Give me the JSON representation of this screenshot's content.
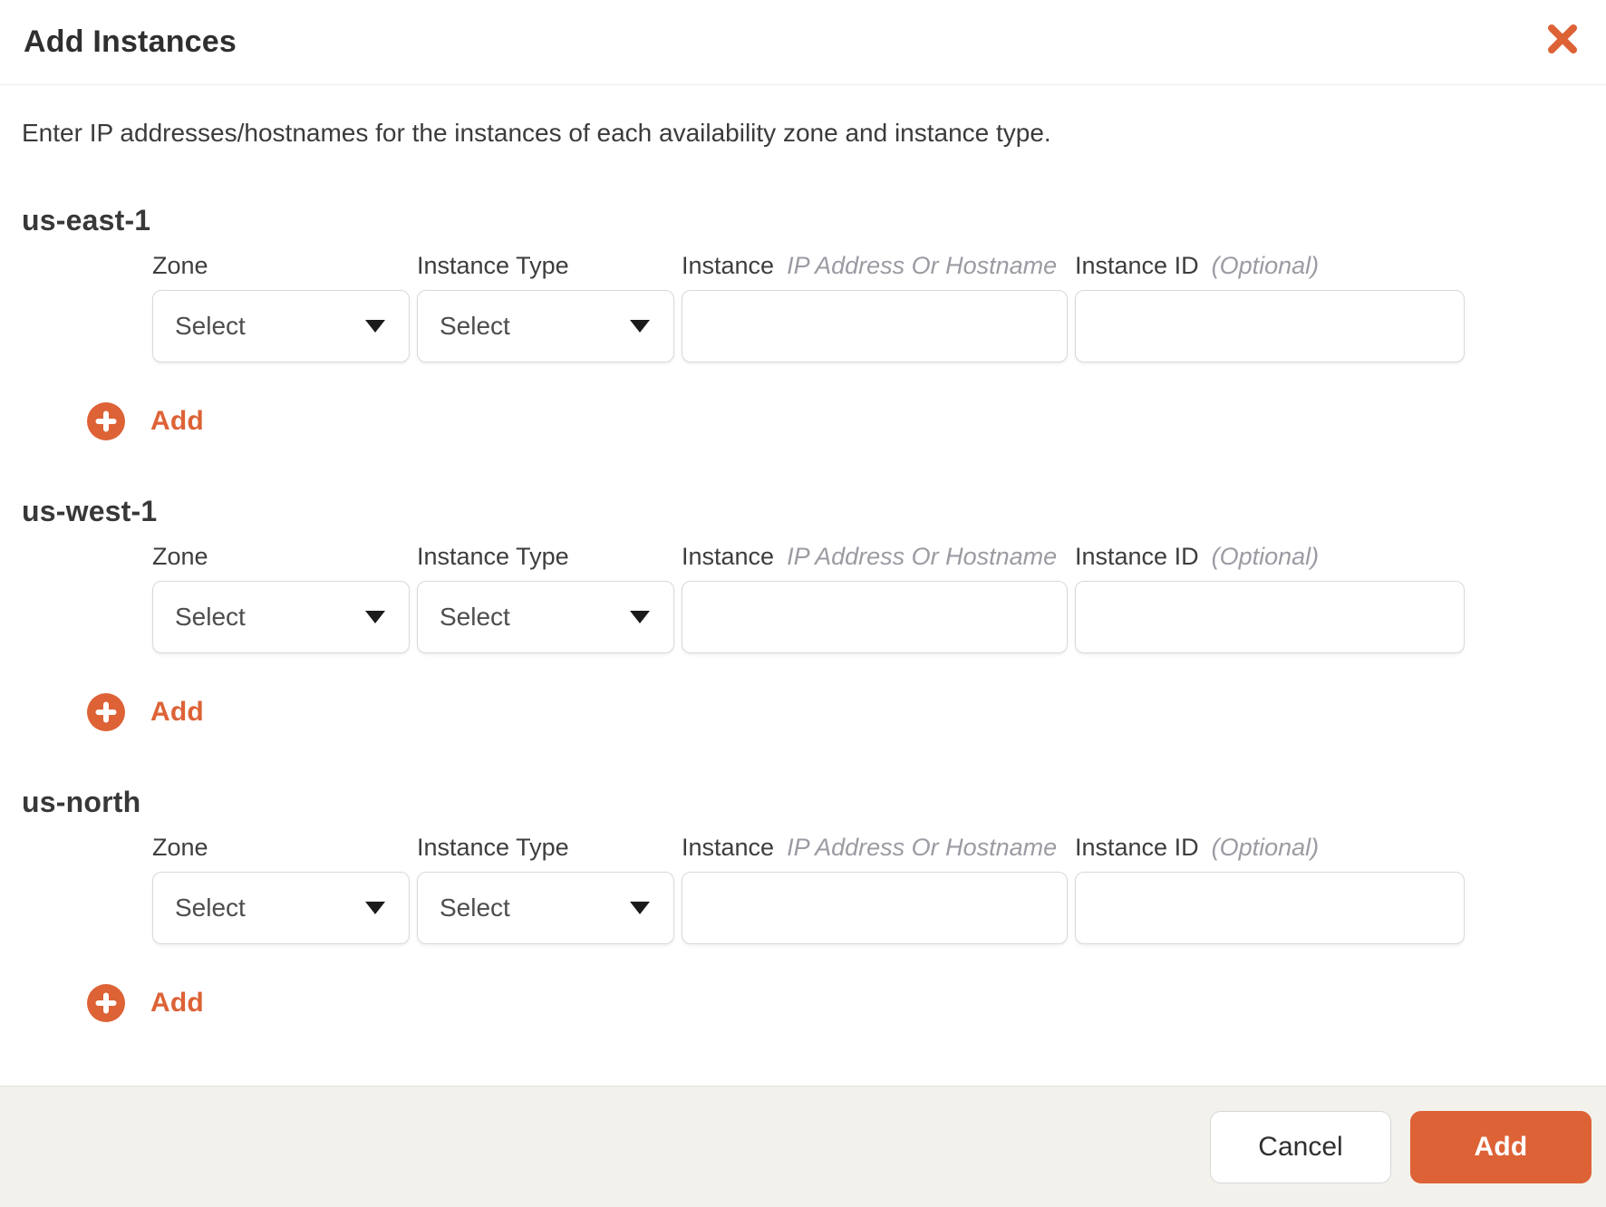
{
  "modal": {
    "title": "Add Instances",
    "description": "Enter IP addresses/hostnames for the instances of each availability zone and instance type."
  },
  "form": {
    "zone_label": "Zone",
    "instance_type_label": "Instance Type",
    "instance_label": "Instance",
    "instance_hint": "IP Address Or Hostname",
    "instance_id_label": "Instance ID",
    "instance_id_hint": "(Optional)",
    "select_placeholder": "Select",
    "add_row_label": "Add",
    "instance_value": "",
    "instance_id_value": ""
  },
  "sections": [
    {
      "title": "us-east-1"
    },
    {
      "title": "us-west-1"
    },
    {
      "title": "us-north"
    }
  ],
  "footer": {
    "cancel_label": "Cancel",
    "add_label": "Add"
  },
  "colors": {
    "accent": "#dd6236",
    "footer_bg": "#f3f1ec"
  }
}
